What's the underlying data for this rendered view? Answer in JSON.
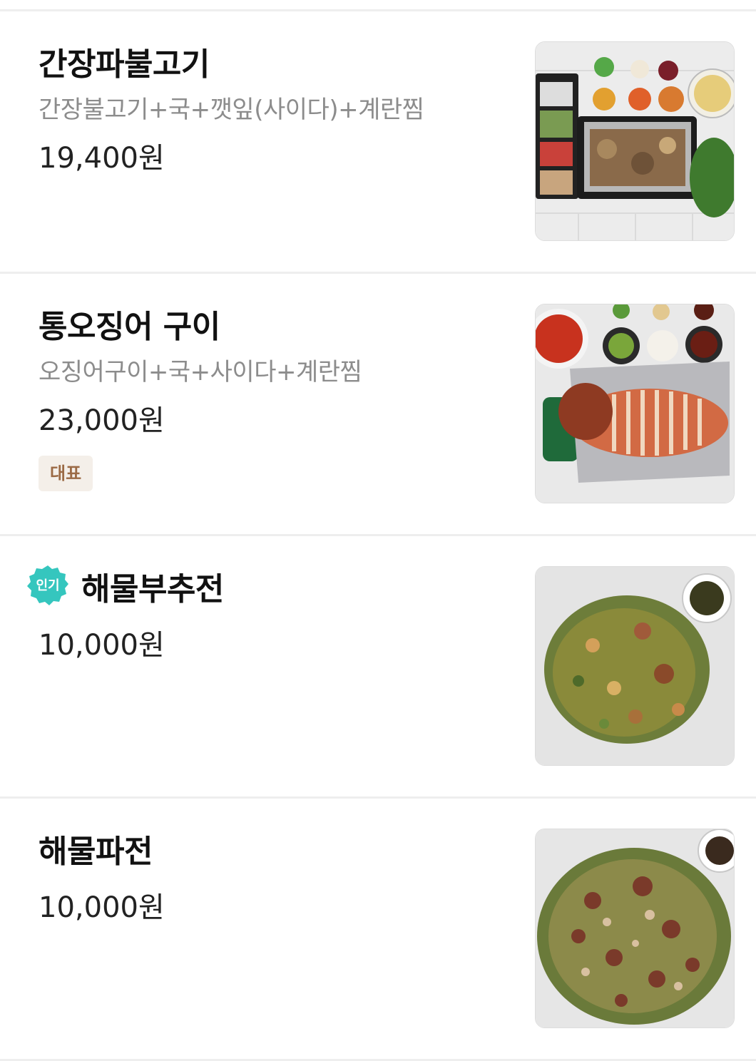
{
  "menu": {
    "items": [
      {
        "name": "간장파불고기",
        "description": "간장불고기+국+깻잎(사이다)+계란찜",
        "price": "19,400원"
      },
      {
        "name": "통오징어 구이",
        "description": "오징어구이+국+사이다+계란찜",
        "price": "23,000원",
        "tag": "대표"
      },
      {
        "name": "해물부추전",
        "price": "10,000원",
        "badge": "인기"
      },
      {
        "name": "해물파전",
        "price": "10,000원"
      }
    ]
  },
  "colors": {
    "badge_teal": "#35c6be",
    "tag_bg": "#f4efe9",
    "tag_text": "#9b6a45",
    "divider": "#eeeeee"
  }
}
